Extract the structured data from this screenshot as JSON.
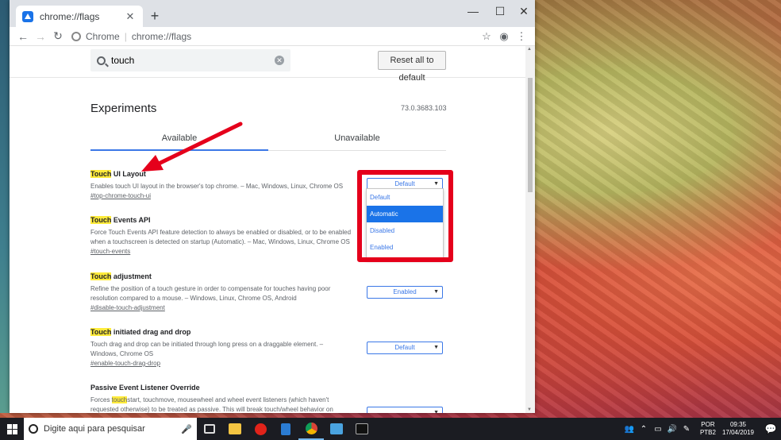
{
  "window": {
    "tab_title": "chrome://flags",
    "tab_close": "✕",
    "new_tab": "+",
    "controls": {
      "minimize": "—",
      "maximize": "☐",
      "close": "✕"
    }
  },
  "toolbar": {
    "back": "←",
    "forward": "→",
    "reload": "↻",
    "omnibox_label": "Chrome",
    "omnibox_url": "chrome://flags",
    "star": "☆",
    "account": "◉",
    "menu": "⋮"
  },
  "flags": {
    "search_value": "touch",
    "clear": "✕",
    "reset_label": "Reset all to default",
    "heading": "Experiments",
    "version": "73.0.3683.103",
    "tabs": [
      {
        "label": "Available"
      },
      {
        "label": "Unavailable"
      }
    ],
    "experiments": [
      {
        "title_hl": "Touch",
        "title_rest": " UI Layout",
        "desc1": "Enables touch UI layout in the browser's top chrome. – Mac, Windows, Linux, Chrome OS",
        "desc2": "",
        "link": "#top-chrome-touch-ui",
        "value": "Default"
      },
      {
        "title_hl": "Touch",
        "title_rest": " Events API",
        "desc1": "Force Touch Events API feature detection to always be enabled or disabled, or to be enabled",
        "desc2": "when a touchscreen is detected on startup (Automatic). – Mac, Windows, Linux, Chrome OS",
        "link": "#touch-events",
        "value": ""
      },
      {
        "title_hl": "Touch",
        "title_rest": " adjustment",
        "desc1": "Refine the position of a touch gesture in order to compensate for touches having poor",
        "desc2": "resolution compared to a mouse. – Windows, Linux, Chrome OS, Android",
        "link": "#disable-touch-adjustment",
        "value": "Enabled"
      },
      {
        "title_hl": "Touch",
        "title_rest": " initiated drag and drop",
        "desc1": "Touch drag and drop can be initiated through long press on a draggable element. –",
        "desc2": "Windows, Chrome OS",
        "link": "#enable-touch-drag-drop",
        "value": "Default"
      },
      {
        "title_hl": "",
        "title_rest": "Passive Event Listener Override",
        "desc1_a": "Forces ",
        "desc1_hl": "touch",
        "desc1_b": "start, touchmove, mousewheel and wheel event listeners (which haven't",
        "desc2": "requested otherwise) to be treated as passive. This will break touch/wheel behavior on",
        "link": "",
        "value": ""
      }
    ],
    "dropdown_options": [
      {
        "label": "Default"
      },
      {
        "label": "Automatic"
      },
      {
        "label": "Disabled"
      },
      {
        "label": "Enabled"
      }
    ],
    "dropdown_selected": "Automatic",
    "select_arrow": "▼"
  },
  "taskbar": {
    "search_placeholder": "Digite aqui para pesquisar",
    "mic": "🎤",
    "lang_top": "POR",
    "lang_bottom": "PTB2",
    "time": "09:35",
    "date": "17/04/2019",
    "notifications": "💬"
  },
  "colors": {
    "highlight_box": "#e5001b",
    "accent": "#3b78e7",
    "search_highlight": "#ffeb3b"
  }
}
